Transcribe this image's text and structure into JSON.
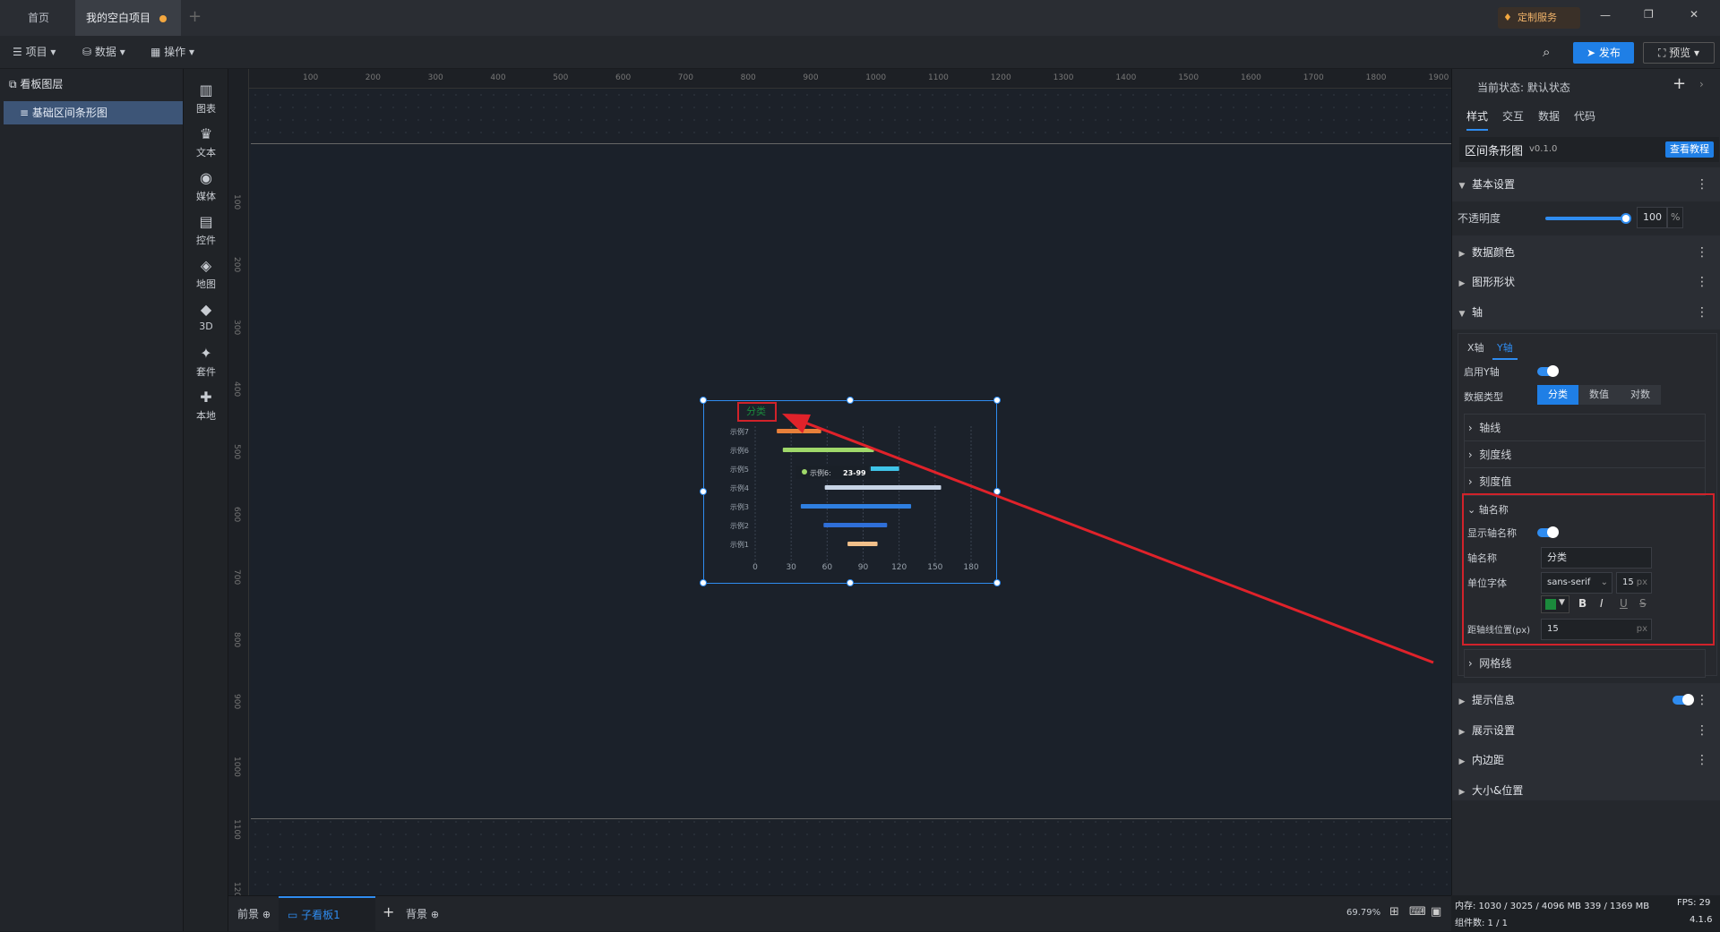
{
  "tabs": [
    {
      "label": "首页"
    },
    {
      "label": "我的空白项目"
    }
  ],
  "window": {
    "service": "定制服务",
    "minimize": "—",
    "restore": "❐",
    "close": "✕"
  },
  "toolbar": {
    "project": "项目",
    "data": "数据",
    "operate": "操作",
    "publish": "发布",
    "preview": "预览"
  },
  "layers": {
    "title": "看板图层",
    "item": "基础区间条形图"
  },
  "components": [
    {
      "icon": "▥",
      "label": "图表"
    },
    {
      "icon": "♛",
      "label": "文本"
    },
    {
      "icon": "◉",
      "label": "媒体"
    },
    {
      "icon": "▤",
      "label": "控件"
    },
    {
      "icon": "◈",
      "label": "地图"
    },
    {
      "icon": "◆",
      "label": "3D"
    },
    {
      "icon": "✦",
      "label": "套件"
    },
    {
      "icon": "✚",
      "label": "本地"
    }
  ],
  "ruler": {
    "h": [
      "100",
      "200",
      "300",
      "400",
      "500",
      "600",
      "700",
      "800",
      "900",
      "1000",
      "1100",
      "1200",
      "1300",
      "1400",
      "1500",
      "1600",
      "1700",
      "1800",
      "1900"
    ],
    "v": [
      "100",
      "200",
      "300",
      "400",
      "500",
      "600",
      "700",
      "800",
      "900",
      "1000",
      "1100",
      "1200"
    ]
  },
  "chart_data": {
    "type": "bar",
    "subtype": "range-bar",
    "yname": "分类",
    "categories": [
      "示例7",
      "示例6",
      "示例5",
      "示例4",
      "示例3",
      "示例2",
      "示例1"
    ],
    "ranges": [
      [
        18,
        55
      ],
      [
        23,
        99
      ],
      [
        95,
        120
      ],
      [
        58,
        155
      ],
      [
        38,
        130
      ],
      [
        57,
        110
      ],
      [
        77,
        102
      ]
    ],
    "colors": [
      "#e8803a",
      "#9fd86a",
      "#3fc4e8",
      "#c7d4e6",
      "#2f7fe0",
      "#2f6fd8",
      "#f2c08a"
    ],
    "xticks": [
      "0",
      "30",
      "60",
      "90",
      "120",
      "150",
      "180"
    ],
    "xlim": [
      0,
      180
    ],
    "tooltip": {
      "label": "示例6:",
      "value": "23-99"
    }
  },
  "right": {
    "state_label": "当前状态:",
    "state_value": "默认状态",
    "tabs": [
      "样式",
      "交互",
      "数据",
      "代码"
    ],
    "component_name": "区间条形图",
    "version": "v0.1.0",
    "tutorial": "查看教程",
    "basic": "基本设置",
    "opacity_label": "不透明度",
    "opacity_value": "100",
    "opacity_unit": "%",
    "data_color": "数据颜色",
    "shape": "图形形状",
    "axis": "轴",
    "axis_tabs": [
      "X轴",
      "Y轴"
    ],
    "enable_y": "启用Y轴",
    "data_type": "数据类型",
    "type_options": [
      "分类",
      "数值",
      "对数"
    ],
    "axis_line": "轴线",
    "tick_line": "刻度线",
    "tick_value": "刻度值",
    "axis_name_sect": "轴名称",
    "show_name": "显示轴名称",
    "name_label": "轴名称",
    "name_value": "分类",
    "font_label": "单位字体",
    "font_value": "sans-serif",
    "font_size": "15",
    "px": "px",
    "dist_label": "距轴线位置(px)",
    "dist_value": "15",
    "grid": "网格线",
    "tooltip": "提示信息",
    "display": "展示设置",
    "padding": "内边距",
    "size_pos": "大小&位置",
    "font_color": "#1b8a3c"
  },
  "bottom": {
    "front": "前景",
    "subboard": "子看板1",
    "back": "背景",
    "zoom": "69.79%"
  },
  "status": {
    "mem": "内存: 1030 / 3025 / 4096 MB 339 / 1369 MB",
    "fps": "FPS: 29",
    "count": "组件数: 1 / 1",
    "ver": "4.1.6"
  }
}
